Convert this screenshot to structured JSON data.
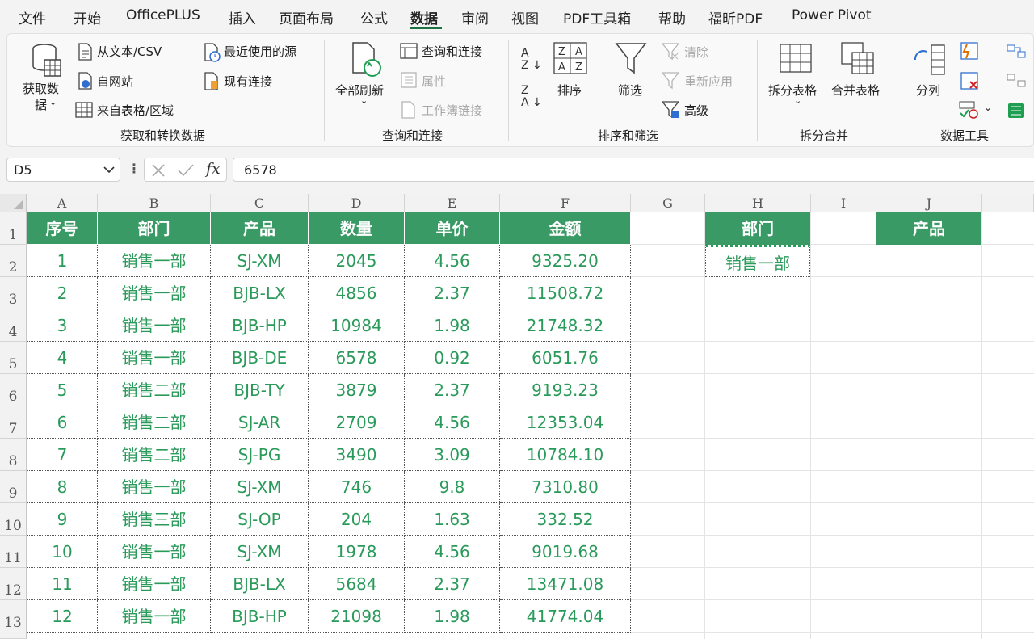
{
  "menu": [
    "文件",
    "开始",
    "OfficePLUS",
    "插入",
    "页面布局",
    "公式",
    "数据",
    "审阅",
    "视图",
    "PDF工具箱",
    "帮助",
    "福昕PDF",
    "Power Pivot"
  ],
  "ribbon": {
    "get_data": "获取数\n据",
    "from_text_csv": "从文本/CSV",
    "from_web": "自网站",
    "from_table": "来自表格/区域",
    "recent_sources": "最近使用的源",
    "existing_connections": "现有连接",
    "group_get_transform": "获取和转换数据",
    "refresh_all": "全部刷新",
    "queries_connections": "查询和连接",
    "properties": "属性",
    "workbook_links": "工作簿链接",
    "group_queries": "查询和连接",
    "sort": "排序",
    "filter": "筛选",
    "clear": "清除",
    "reapply": "重新应用",
    "advanced": "高级",
    "group_sort_filter": "排序和筛选",
    "split_table": "拆分表格",
    "merge_table": "合并表格",
    "group_split_merge": "拆分合并",
    "text_to_columns": "分列",
    "group_data_tools": "数据工具"
  },
  "formula_bar": {
    "name_box": "D5",
    "fx": "fx",
    "value": "6578"
  },
  "columns": [
    "A",
    "B",
    "C",
    "D",
    "E",
    "F",
    "G",
    "H",
    "I",
    "J"
  ],
  "rows": [
    "1",
    "2",
    "3",
    "4",
    "5",
    "6",
    "7",
    "8",
    "9",
    "10",
    "11",
    "12",
    "13"
  ],
  "table": {
    "headers": [
      "序号",
      "部门",
      "产品",
      "数量",
      "单价",
      "金额"
    ],
    "rows": [
      [
        "1",
        "销售一部",
        "SJ-XM",
        "2045",
        "4.56",
        "9325.20"
      ],
      [
        "2",
        "销售一部",
        "BJB-LX",
        "4856",
        "2.37",
        "11508.72"
      ],
      [
        "3",
        "销售一部",
        "BJB-HP",
        "10984",
        "1.98",
        "21748.32"
      ],
      [
        "4",
        "销售一部",
        "BJB-DE",
        "6578",
        "0.92",
        "6051.76"
      ],
      [
        "5",
        "销售二部",
        "BJB-TY",
        "3879",
        "2.37",
        "9193.23"
      ],
      [
        "6",
        "销售二部",
        "SJ-AR",
        "2709",
        "4.56",
        "12353.04"
      ],
      [
        "7",
        "销售二部",
        "SJ-PG",
        "3490",
        "3.09",
        "10784.10"
      ],
      [
        "8",
        "销售一部",
        "SJ-XM",
        "746",
        "9.8",
        "7310.80"
      ],
      [
        "9",
        "销售三部",
        "SJ-OP",
        "204",
        "1.63",
        "332.52"
      ],
      [
        "10",
        "销售一部",
        "SJ-XM",
        "1978",
        "4.56",
        "9019.68"
      ],
      [
        "11",
        "销售一部",
        "BJB-LX",
        "5684",
        "2.37",
        "13471.08"
      ],
      [
        "12",
        "销售一部",
        "BJB-HP",
        "21098",
        "1.98",
        "41774.04"
      ]
    ]
  },
  "criteria": {
    "dept_header": "部门",
    "dept_value": "销售一部",
    "product_header": "产品"
  },
  "colors": {
    "header_green": "#3a9a65",
    "text_green": "#2a9a5a",
    "accent": "#1e7145"
  }
}
